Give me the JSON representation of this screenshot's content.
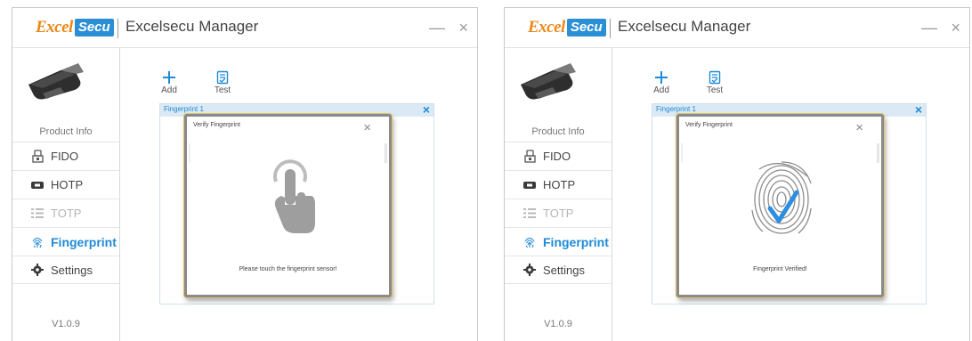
{
  "windows": [
    {
      "logo": {
        "prefix": "Excel",
        "box": "Secu"
      },
      "title": "Excelsecu Manager",
      "product_info": "Product Info",
      "nav": [
        "FIDO",
        "HOTP",
        "TOTP",
        "Fingerprint",
        "Settings"
      ],
      "version": "V1.0.9",
      "toolbar": {
        "add": "Add",
        "test": "Test"
      },
      "panel_tab": "Fingerprint 1",
      "dialog": {
        "title": "Verify Fingerprint",
        "message": "Please touch the fingerprint sensor!",
        "graphic": "touch-hand-icon"
      }
    },
    {
      "logo": {
        "prefix": "Excel",
        "box": "Secu"
      },
      "title": "Excelsecu Manager",
      "product_info": "Product Info",
      "nav": [
        "FIDO",
        "HOTP",
        "TOTP",
        "Fingerprint",
        "Settings"
      ],
      "version": "V1.0.9",
      "toolbar": {
        "add": "Add",
        "test": "Test"
      },
      "panel_tab": "Fingerprint 1",
      "dialog": {
        "title": "Verify Fingerprint",
        "message": "Fingerprint Verified!",
        "graphic": "fingerprint-verified-icon"
      }
    }
  ],
  "controls": {
    "minimize": "—",
    "close": "×",
    "panel_close": "×",
    "dialog_close": "×"
  },
  "colors": {
    "accent": "#1e8ad8",
    "logo_orange": "#e8891a",
    "logo_blue": "#2b8fd6",
    "disabled": "#b4b4b4"
  }
}
